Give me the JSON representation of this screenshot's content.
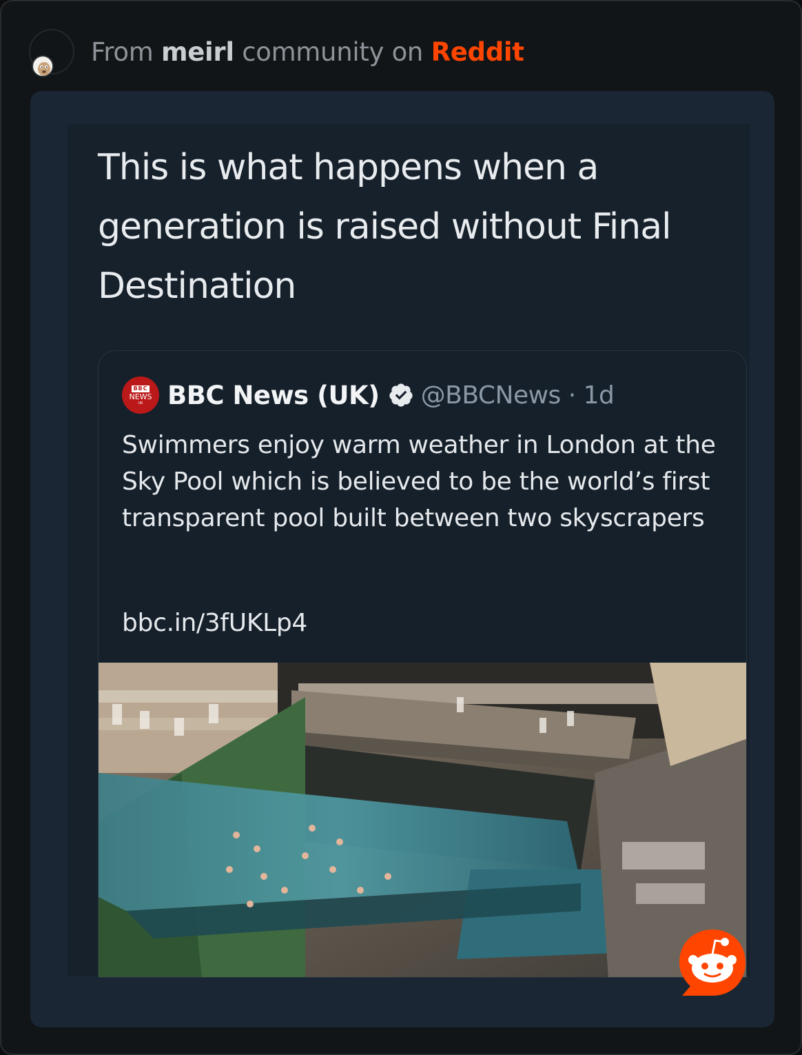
{
  "header": {
    "prefix": "From",
    "community": "meirl",
    "middle": "community on",
    "platform": "Reddit"
  },
  "post": {
    "caption": "This is what happens when a generation is raised without Final Destination"
  },
  "tweet": {
    "logo": {
      "line1": "BBC",
      "line2": "NEWS",
      "line3": "UK"
    },
    "display_name": "BBC News (UK)",
    "handle_time": "@BBCNews · 1d",
    "text": "Swimmers enjoy warm weather in London at the Sky Pool which is believed to be the world’s first transparent pool built between two skyscrapers",
    "link": "bbc.in/3fUKLp4",
    "image_subject": "aerial view of transparent sky pool between two buildings"
  },
  "colors": {
    "reddit_orange": "#ff4500",
    "bbc_red": "#bb1919",
    "verified_badge": "#e9ecef"
  },
  "icons": [
    "user-avatar-icon",
    "verified-badge-icon",
    "reddit-snoo-icon"
  ]
}
